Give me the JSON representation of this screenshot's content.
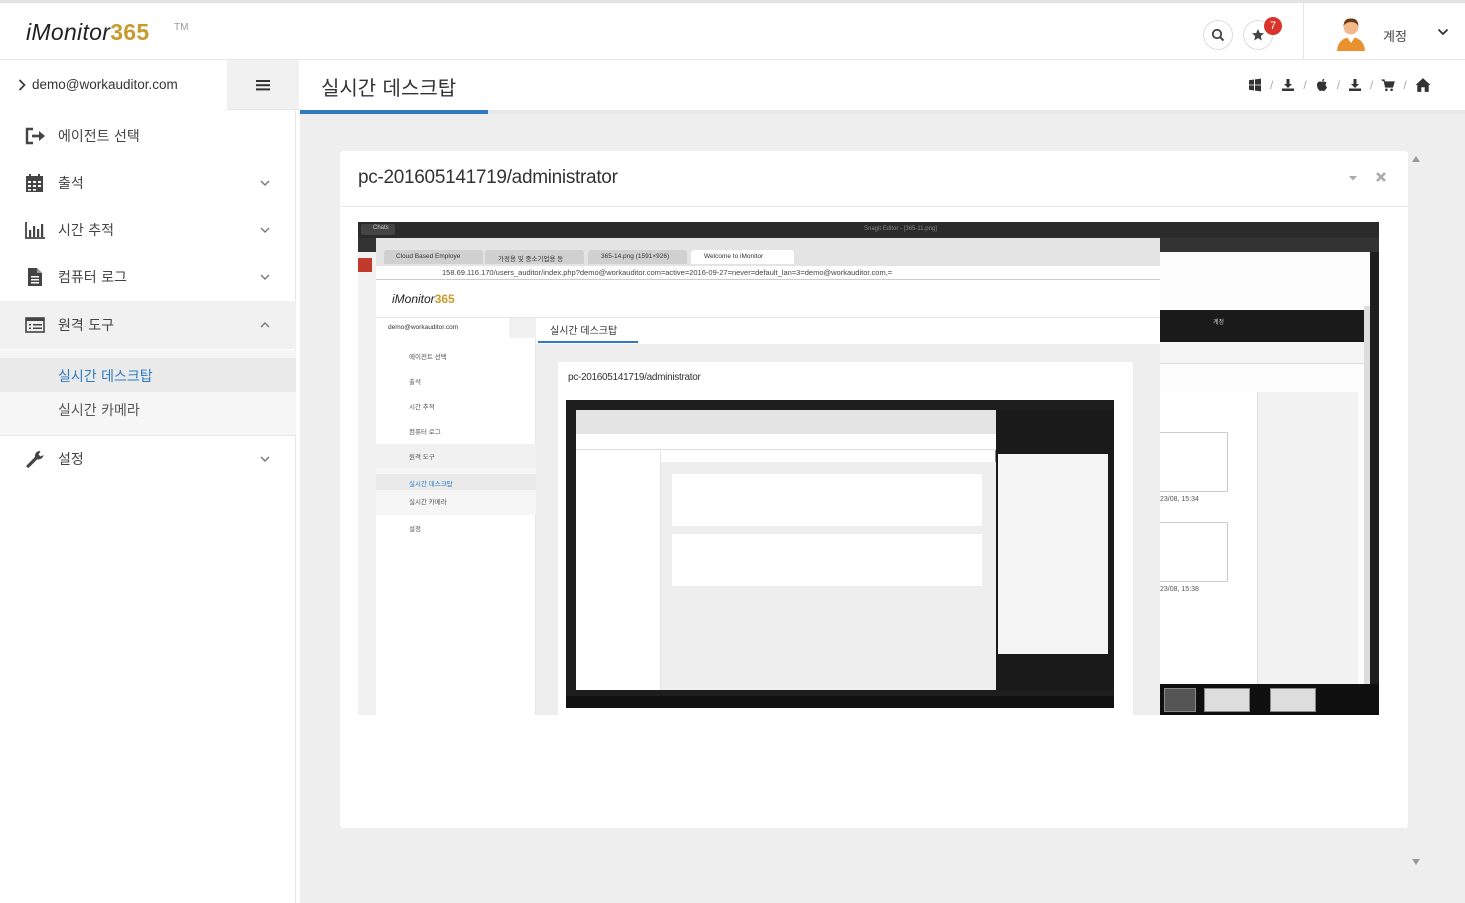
{
  "header": {
    "logo_main": "iMonitor",
    "logo_num": "365",
    "logo_tm": "TM",
    "notification_count": "7",
    "account_label": "계정"
  },
  "sidebar": {
    "user_email": "demo@workauditor.com",
    "items": [
      {
        "label": "에이전트 선택",
        "icon": "sign-out-icon"
      },
      {
        "label": "출석",
        "icon": "calendar-icon"
      },
      {
        "label": "시간 추적",
        "icon": "bar-chart-icon"
      },
      {
        "label": "컴퓨터 로그",
        "icon": "file-icon"
      },
      {
        "label": "원격 도구",
        "icon": "list-icon"
      },
      {
        "label": "설정",
        "icon": "wrench-icon"
      }
    ],
    "sub_items": [
      {
        "label": "실시간 데스크탑",
        "active": true
      },
      {
        "label": "실시간 카메라",
        "active": false
      }
    ]
  },
  "main": {
    "page_title": "실시간 데스크탑",
    "os_links": [
      "windows-icon",
      "download-icon",
      "apple-icon",
      "download-icon",
      "cart-icon",
      "home-icon"
    ],
    "panel_title": "pc-201605141719/administrator"
  },
  "screenshot": {
    "url": "158.69.116.170/users_auditor/index.php?demo@workauditor.com=active=2016-09-27=never=default_lan=3=demo@workauditor.com,=",
    "tabs": [
      "Cloud Based Employe",
      "가정용 및 중소기업용 동",
      "365-14.png (1591×926)",
      "Welcome to iMonitor"
    ],
    "app_title": "Snagit Editor - [365-11.png]",
    "chats_label": "Chats",
    "inner_email": "demo@workauditor.com",
    "inner_page_title": "실시간 데스크탑",
    "inner_panel_title": "pc-201605141719/administrator",
    "inner_account": "계정",
    "inner_items": [
      "에이전트 선택",
      "출석",
      "시간 추적",
      "컴퓨터 로그",
      "원격 도구",
      "실시간 데스크탑",
      "실시간 카메라",
      "설정"
    ],
    "time_1": "23/08, 15:34",
    "time_2": "23/08, 15:38"
  },
  "colors": {
    "accent": "#2e7bc4",
    "logo_gold": "#c99a2e",
    "badge_red": "#d9342b",
    "content_bg": "#eeeeee"
  }
}
